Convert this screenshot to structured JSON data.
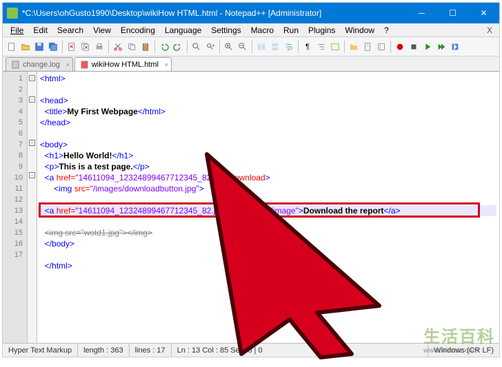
{
  "window": {
    "title": "*C:\\Users\\ohGusto1990\\Desktop\\wikiHow HTML.html - Notepad++ [Administrator]"
  },
  "menu": {
    "file": "File",
    "edit": "Edit",
    "search": "Search",
    "view": "View",
    "encoding": "Encoding",
    "language": "Language",
    "settings": "Settings",
    "macro": "Macro",
    "run": "Run",
    "plugins": "Plugins",
    "window": "Window",
    "help": "?"
  },
  "tabs": [
    {
      "label": "change.log",
      "active": false
    },
    {
      "label": "wikiHow HTML.html",
      "active": true
    }
  ],
  "code": {
    "lines": [
      {
        "n": 1,
        "fold": "minus",
        "html": "<span class='t-tag'>&lt;html&gt;</span>"
      },
      {
        "n": 2,
        "fold": "",
        "html": ""
      },
      {
        "n": 3,
        "fold": "minus",
        "html": "<span class='t-tag'>&lt;head&gt;</span>"
      },
      {
        "n": 4,
        "fold": "",
        "html": "  <span class='t-tag'>&lt;title&gt;</span><span class='t-txt'>My First Webpage</span><span class='t-tag'>&lt;/html&gt;</span>"
      },
      {
        "n": 5,
        "fold": "",
        "html": "<span class='t-tag'>&lt;/head&gt;</span>"
      },
      {
        "n": 6,
        "fold": "",
        "html": ""
      },
      {
        "n": 7,
        "fold": "minus",
        "html": "<span class='t-tag'>&lt;body&gt;</span>"
      },
      {
        "n": 8,
        "fold": "",
        "html": "  <span class='t-tag'>&lt;h1&gt;</span><span class='t-txt'>Hello World!</span><span class='t-tag'>&lt;/h1&gt;</span>"
      },
      {
        "n": 9,
        "fold": "",
        "html": "  <span class='t-tag'>&lt;p&gt;</span><span class='t-txt'>This is a test page.</span><span class='t-tag'>&lt;/p&gt;</span>"
      },
      {
        "n": 10,
        "fold": "minus",
        "html": "  <span class='t-tag'>&lt;a</span> <span class='t-attr'>href=</span><span class='t-val'>\"14611094_12324899467712345_82.jpg\"</span> <span class='t-attr'>download</span><span class='t-tag'>&gt;</span>"
      },
      {
        "n": 11,
        "fold": "",
        "html": "      <span class='t-tag'>&lt;img</span> <span class='t-attr'>src=</span><span class='t-val'>\"/images/downloadbutton.jpg\"</span><span class='t-tag'>&gt;</span>"
      },
      {
        "n": 12,
        "fold": "",
        "html": ""
      },
      {
        "n": 13,
        "fold": "",
        "html": "  <span class='t-tag'>&lt;a</span> <span class='t-attr'>href=</span><span class='t-val'>\"14611094_12324899467712345_82.jpg\"</span> <span class='t-attr'>download=</span><span class='t-val'>\"image\"</span><span class='t-tag'>&gt;</span><span class='t-txt'>Download the report</span><span class='t-tag'>&lt;/a&gt;</span>",
        "current": true
      },
      {
        "n": 14,
        "fold": "",
        "html": "  <span style='text-decoration:line-through;color:#888'>&lt;img src=\"wotd1.jpg\"&gt;&lt;/img&gt;</span>"
      },
      {
        "n": 15,
        "fold": "",
        "html": "  <span class='t-tag'>&lt;/body&gt;</span>"
      },
      {
        "n": 16,
        "fold": "",
        "html": ""
      },
      {
        "n": 17,
        "fold": "",
        "html": "  <span class='t-tag'>&lt;/html&gt;</span>"
      }
    ]
  },
  "status": {
    "lang": "Hyper Text Markup",
    "length": "length : 363",
    "lines": "lines : 17",
    "pos": "Ln : 13    Col : 85    Sel : 0 | 0",
    "os": "Windows (CR LF)"
  },
  "watermark": {
    "main": "生活百科",
    "sub": "www.bimeiz.com"
  }
}
